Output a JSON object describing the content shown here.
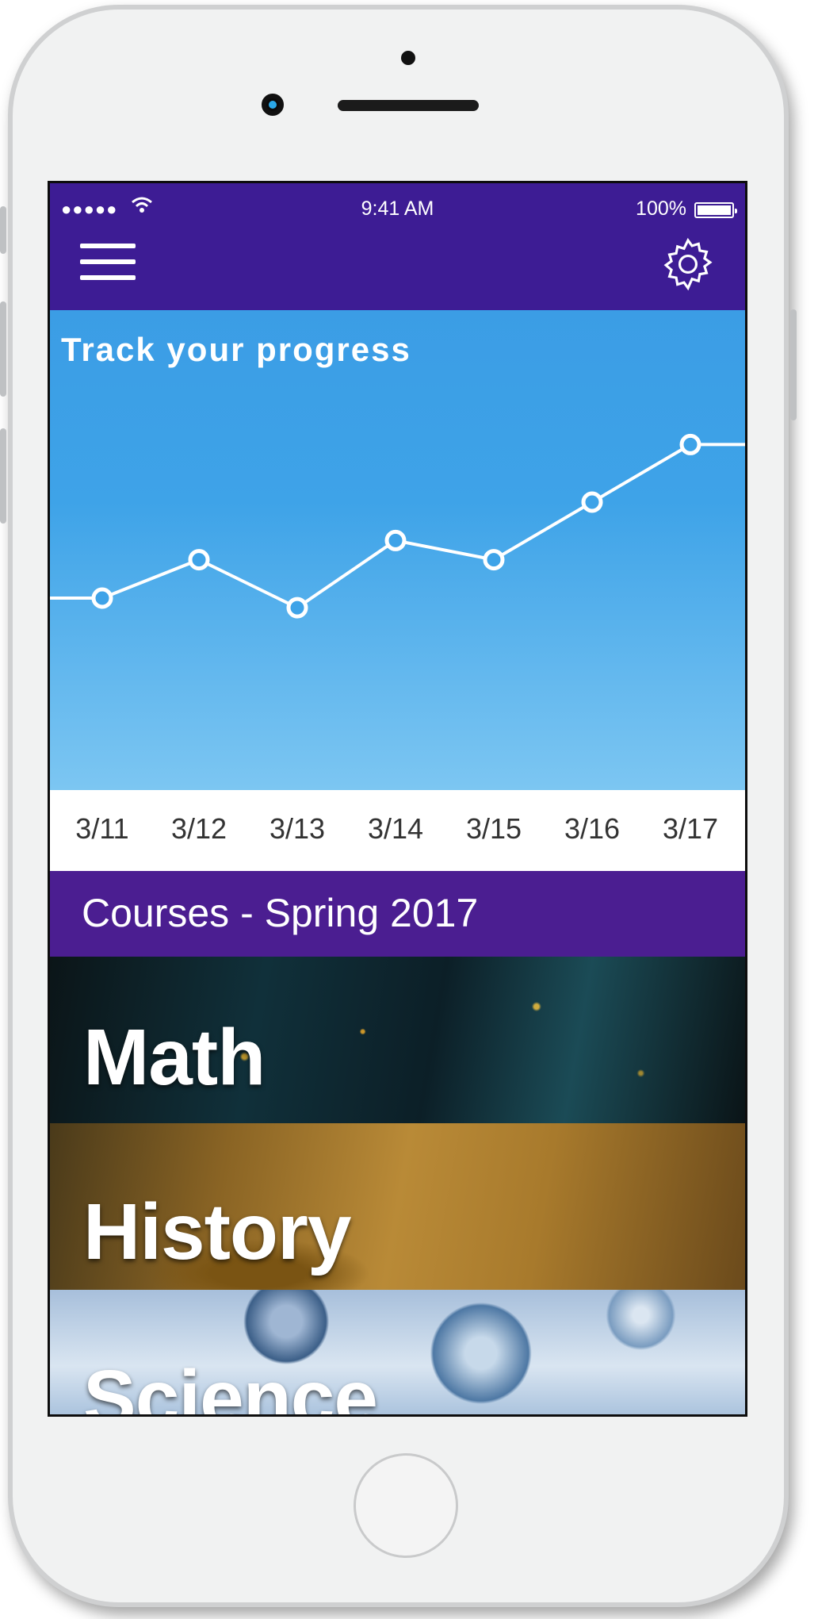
{
  "status_bar": {
    "signal": "●●●●●",
    "time": "9:41 AM",
    "battery": "100%",
    "battery_level": 1.0
  },
  "header": {
    "menu_icon": "hamburger-menu-icon",
    "settings_icon": "gear-icon"
  },
  "chart_data": {
    "type": "line",
    "title": "Track your progress",
    "categories": [
      "3/11",
      "3/12",
      "3/13",
      "3/14",
      "3/15",
      "3/16",
      "3/17"
    ],
    "series": [
      {
        "values": [
          40,
          48,
          38,
          52,
          48,
          60,
          72
        ]
      }
    ],
    "ylim": [
      0,
      100
    ],
    "grid": false,
    "color": "#ffffff"
  },
  "courses": {
    "title": "Courses - Spring 2017",
    "items": [
      {
        "label": "Math"
      },
      {
        "label": "History"
      },
      {
        "label": "Science"
      }
    ]
  },
  "colors": {
    "header": "#3d1c94",
    "courses_header": "#4b1e91",
    "chart_top": "#3b9de5",
    "chart_bottom": "#7cc6f2"
  }
}
